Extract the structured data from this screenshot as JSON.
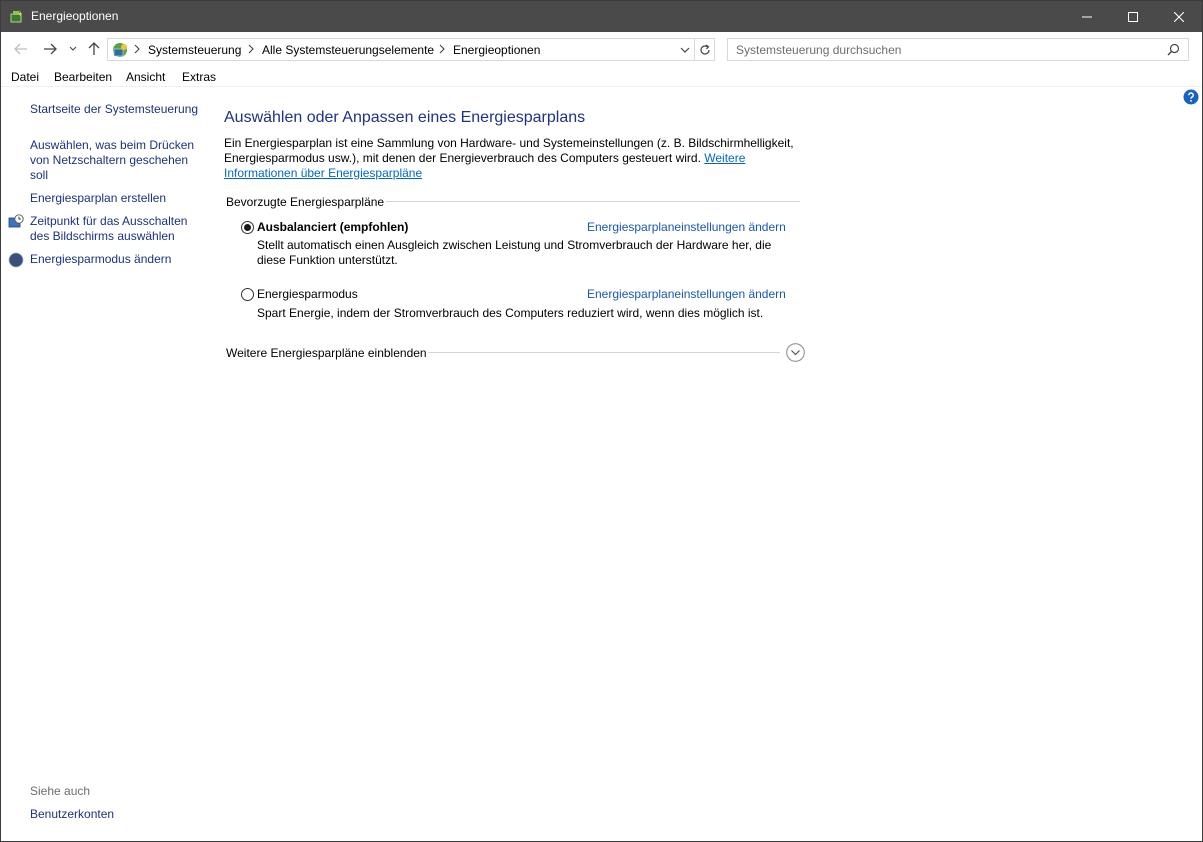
{
  "window": {
    "title": "Energieoptionen"
  },
  "address": {
    "crumbs": [
      "Systemsteuerung",
      "Alle Systemsteuerungselemente",
      "Energieoptionen"
    ]
  },
  "search": {
    "placeholder": "Systemsteuerung durchsuchen"
  },
  "menu": [
    "Datei",
    "Bearbeiten",
    "Ansicht",
    "Extras"
  ],
  "sidebar": {
    "home": "Startseite der Systemsteuerung",
    "power_buttons": "Auswählen, was beim Drücken von Netzschaltern geschehen soll",
    "create_plan": "Energiesparplan erstellen",
    "display_off": "Zeitpunkt für das Ausschalten des Bildschirms auswählen",
    "sleep_mode": "Energiesparmodus ändern",
    "see_also": "Siehe auch",
    "user_accounts": "Benutzerkonten"
  },
  "main": {
    "title": "Auswählen oder Anpassen eines Energiesparplans",
    "intro": "Ein Energiesparplan ist eine Sammlung von Hardware- und Systemeinstellungen (z. B. Bildschirmhelligkeit, Energiesparmodus usw.), mit denen der Energieverbrauch des Computers gesteuert wird. ",
    "intro_link": "Weitere Informationen über Energiesparpläne",
    "group_label": "Bevorzugte Energiesparpläne",
    "plans": [
      {
        "name": "Ausbalanciert (empfohlen)",
        "selected": true,
        "link": "Energiesparplaneinstellungen ändern",
        "desc": "Stellt automatisch einen Ausgleich zwischen Leistung und Stromverbrauch der Hardware her, die diese Funktion unterstützt."
      },
      {
        "name": "Energiesparmodus",
        "selected": false,
        "link": "Energiesparplaneinstellungen ändern",
        "desc": "Spart Energie, indem der Stromverbrauch des Computers reduziert wird, wenn dies möglich ist."
      }
    ],
    "more_plans": "Weitere Energiesparpläne einblenden"
  },
  "colors": {
    "titlebar": "#4a4a4a",
    "link": "#1a3380",
    "heading": "#1e3287",
    "help": "#1565c0"
  }
}
